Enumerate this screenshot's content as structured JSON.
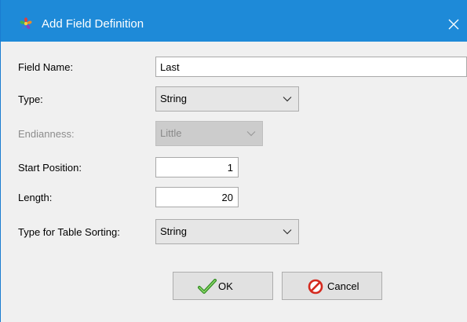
{
  "window": {
    "title": "Add Field Definition",
    "app_icon": "app-flower-icon",
    "close_icon": "close-icon",
    "titlebar_color": "#1e8ad8"
  },
  "form": {
    "field_name": {
      "label": "Field Name:",
      "value": "Last"
    },
    "type": {
      "label": "Type:",
      "selected": "String"
    },
    "endianness": {
      "label": "Endianness:",
      "selected": "Little",
      "enabled": false
    },
    "start_position": {
      "label": "Start Position:",
      "value": "1"
    },
    "length": {
      "label": "Length:",
      "value": "20"
    },
    "sort_type": {
      "label": "Type for Table Sorting:",
      "selected": "String"
    }
  },
  "buttons": {
    "ok": {
      "label": "OK",
      "icon": "checkmark-icon"
    },
    "cancel": {
      "label": "Cancel",
      "icon": "no-entry-icon"
    }
  }
}
